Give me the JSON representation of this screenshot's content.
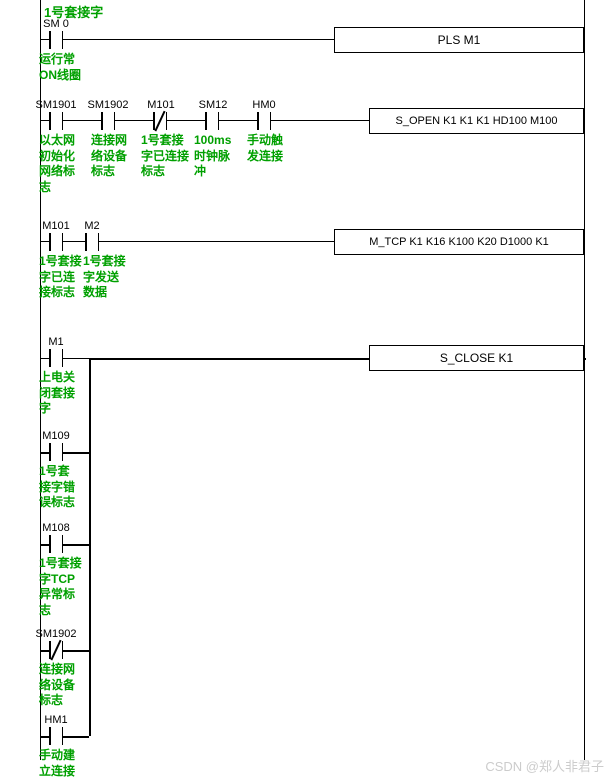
{
  "section_title": "1号套接字",
  "rung1": {
    "contacts": [
      {
        "addr": "SM 0",
        "desc": "运行常\nON线圈",
        "nc": false
      }
    ],
    "output": "PLS    M1"
  },
  "rung2": {
    "contacts": [
      {
        "addr": "SM1901",
        "desc": "以太网\n初始化\n网络标\n志",
        "nc": false
      },
      {
        "addr": "SM1902",
        "desc": "连接网\n络设备\n标志",
        "nc": false
      },
      {
        "addr": "M101",
        "desc": "1号套接\n字已连接\n标志",
        "nc": true
      },
      {
        "addr": "SM12",
        "desc": "100ms\n时钟脉\n冲",
        "nc": false
      },
      {
        "addr": "HM0",
        "desc": "手动触\n发连接",
        "nc": false
      }
    ],
    "output": "S_OPEN K1 K1 K1 HD100 M100"
  },
  "rung3": {
    "contacts": [
      {
        "addr": "M101",
        "desc": "1号套接\n字已连\n接标志",
        "nc": false
      },
      {
        "addr": "M2",
        "desc": "1号套接\n字发送\n数据",
        "nc": false
      }
    ],
    "output": "M_TCP  K1    K16 K100 K20 D1000 K1"
  },
  "rung4": {
    "branches": [
      {
        "addr": "M1",
        "desc": "上电关\n闭套接\n字",
        "nc": false
      },
      {
        "addr": "M109",
        "desc": "1号套\n接字错\n误标志",
        "nc": false
      },
      {
        "addr": "M108",
        "desc": "1号套接\n字TCP\n异常标\n志",
        "nc": false
      },
      {
        "addr": "SM1902",
        "desc": "连接网\n络设备\n标志",
        "nc": true
      },
      {
        "addr": "HM1",
        "desc": "手动建\n立连接",
        "nc": false
      }
    ],
    "output": "S_CLOSE    K1"
  },
  "watermark": "CSDN @郑人非君子"
}
